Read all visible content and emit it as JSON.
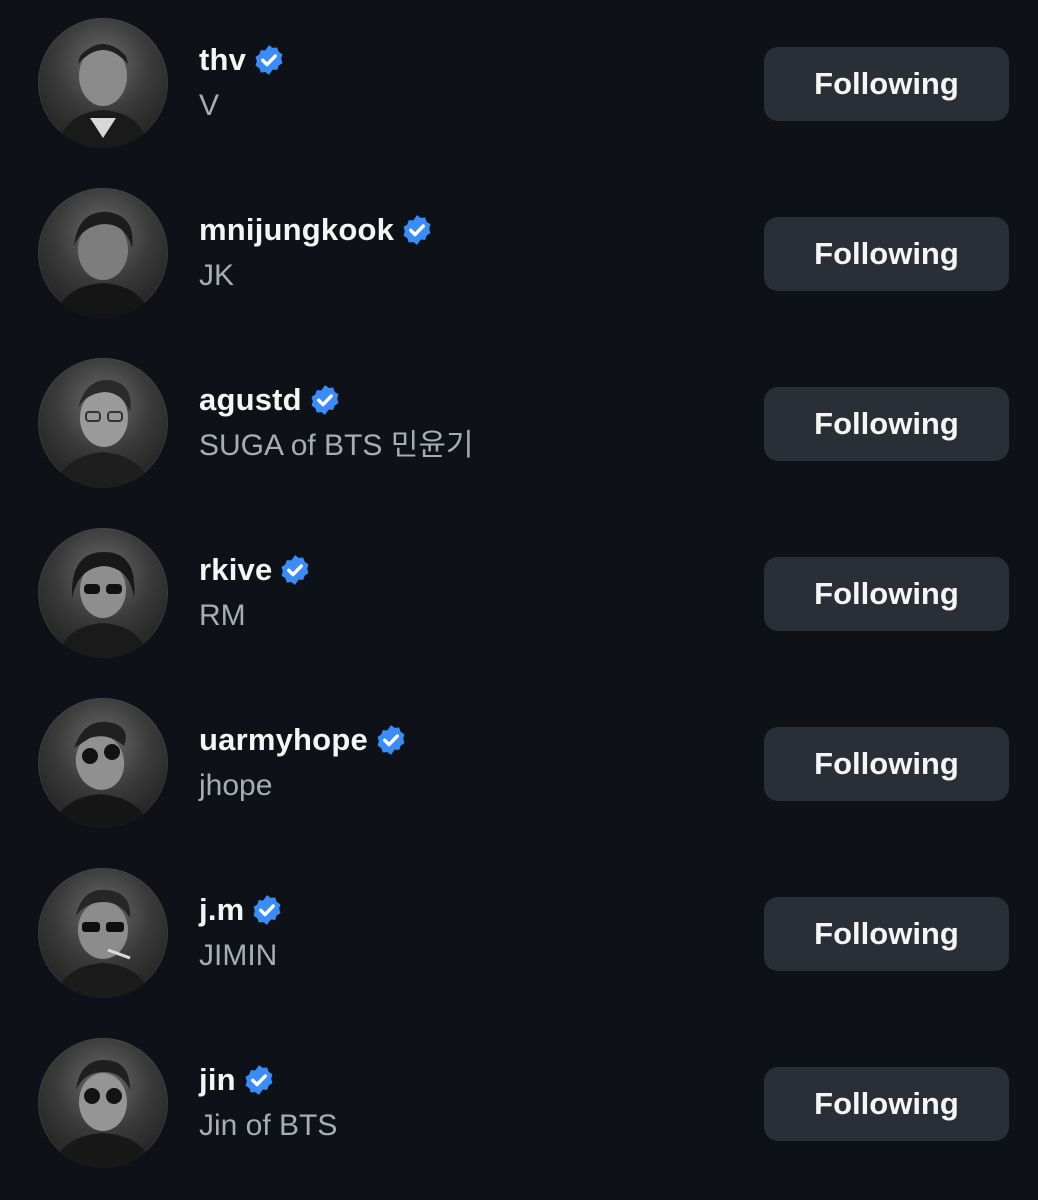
{
  "colors": {
    "background": "#0e1117",
    "verified_badge": "#3b8cf6",
    "button_bg": "#2a2e36",
    "secondary_text": "#a8acb3"
  },
  "following_list": [
    {
      "handle": "thv",
      "display_name": "V",
      "verified": true,
      "button_label": "Following",
      "avatar_icon": "profile-photo"
    },
    {
      "handle": "mnijungkook",
      "display_name": "JK",
      "verified": true,
      "button_label": "Following",
      "avatar_icon": "profile-photo"
    },
    {
      "handle": "agustd",
      "display_name": "SUGA of BTS 민윤기",
      "verified": true,
      "button_label": "Following",
      "avatar_icon": "profile-photo"
    },
    {
      "handle": "rkive",
      "display_name": "RM",
      "verified": true,
      "button_label": "Following",
      "avatar_icon": "profile-photo"
    },
    {
      "handle": "uarmyhope",
      "display_name": "jhope",
      "verified": true,
      "button_label": "Following",
      "avatar_icon": "profile-photo"
    },
    {
      "handle": "j.m",
      "display_name": "JIMIN",
      "verified": true,
      "button_label": "Following",
      "avatar_icon": "profile-photo"
    },
    {
      "handle": "jin",
      "display_name": "Jin of BTS",
      "verified": true,
      "button_label": "Following",
      "avatar_icon": "profile-photo"
    }
  ]
}
